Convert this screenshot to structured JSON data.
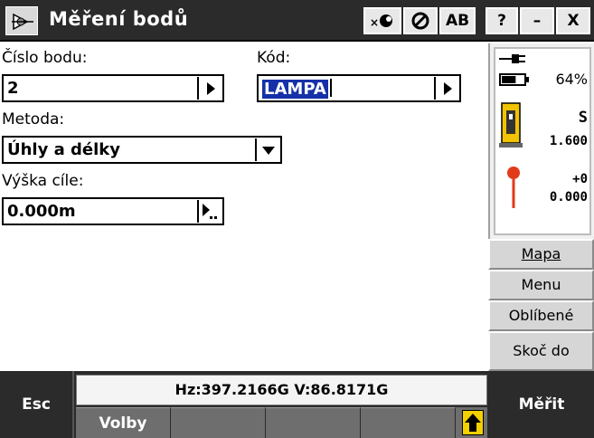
{
  "window": {
    "title": "Měření bodů",
    "buttons": {
      "close_x_small": "",
      "ab": "AB",
      "help": "?",
      "minimize": "–",
      "close": "X"
    }
  },
  "form": {
    "point_number": {
      "label": "Číslo bodu:",
      "value": "2"
    },
    "code": {
      "label": "Kód:",
      "value": "LAMPA"
    },
    "method": {
      "label": "Metoda:",
      "value": "Úhly a délky"
    },
    "target_height": {
      "label": "Výška cíle:",
      "value": "0.000m"
    }
  },
  "status": {
    "battery_percent": "64%",
    "instrument_face": "S",
    "instrument_height": "1.600",
    "prism_constant": "+0",
    "target_height": "0.000",
    "battery_level": 0.64
  },
  "side_buttons": [
    {
      "id": "map",
      "label": "Mapa"
    },
    {
      "id": "menu",
      "label": "Menu"
    },
    {
      "id": "favorites",
      "label": "Oblíbené"
    },
    {
      "id": "jump",
      "label": "Skoč do"
    }
  ],
  "bottom": {
    "esc": "Esc",
    "measure": "Měřit",
    "readout": "Hz:397.2166G  V:86.8171G",
    "softkeys": [
      "Volby",
      "",
      "",
      ""
    ]
  }
}
